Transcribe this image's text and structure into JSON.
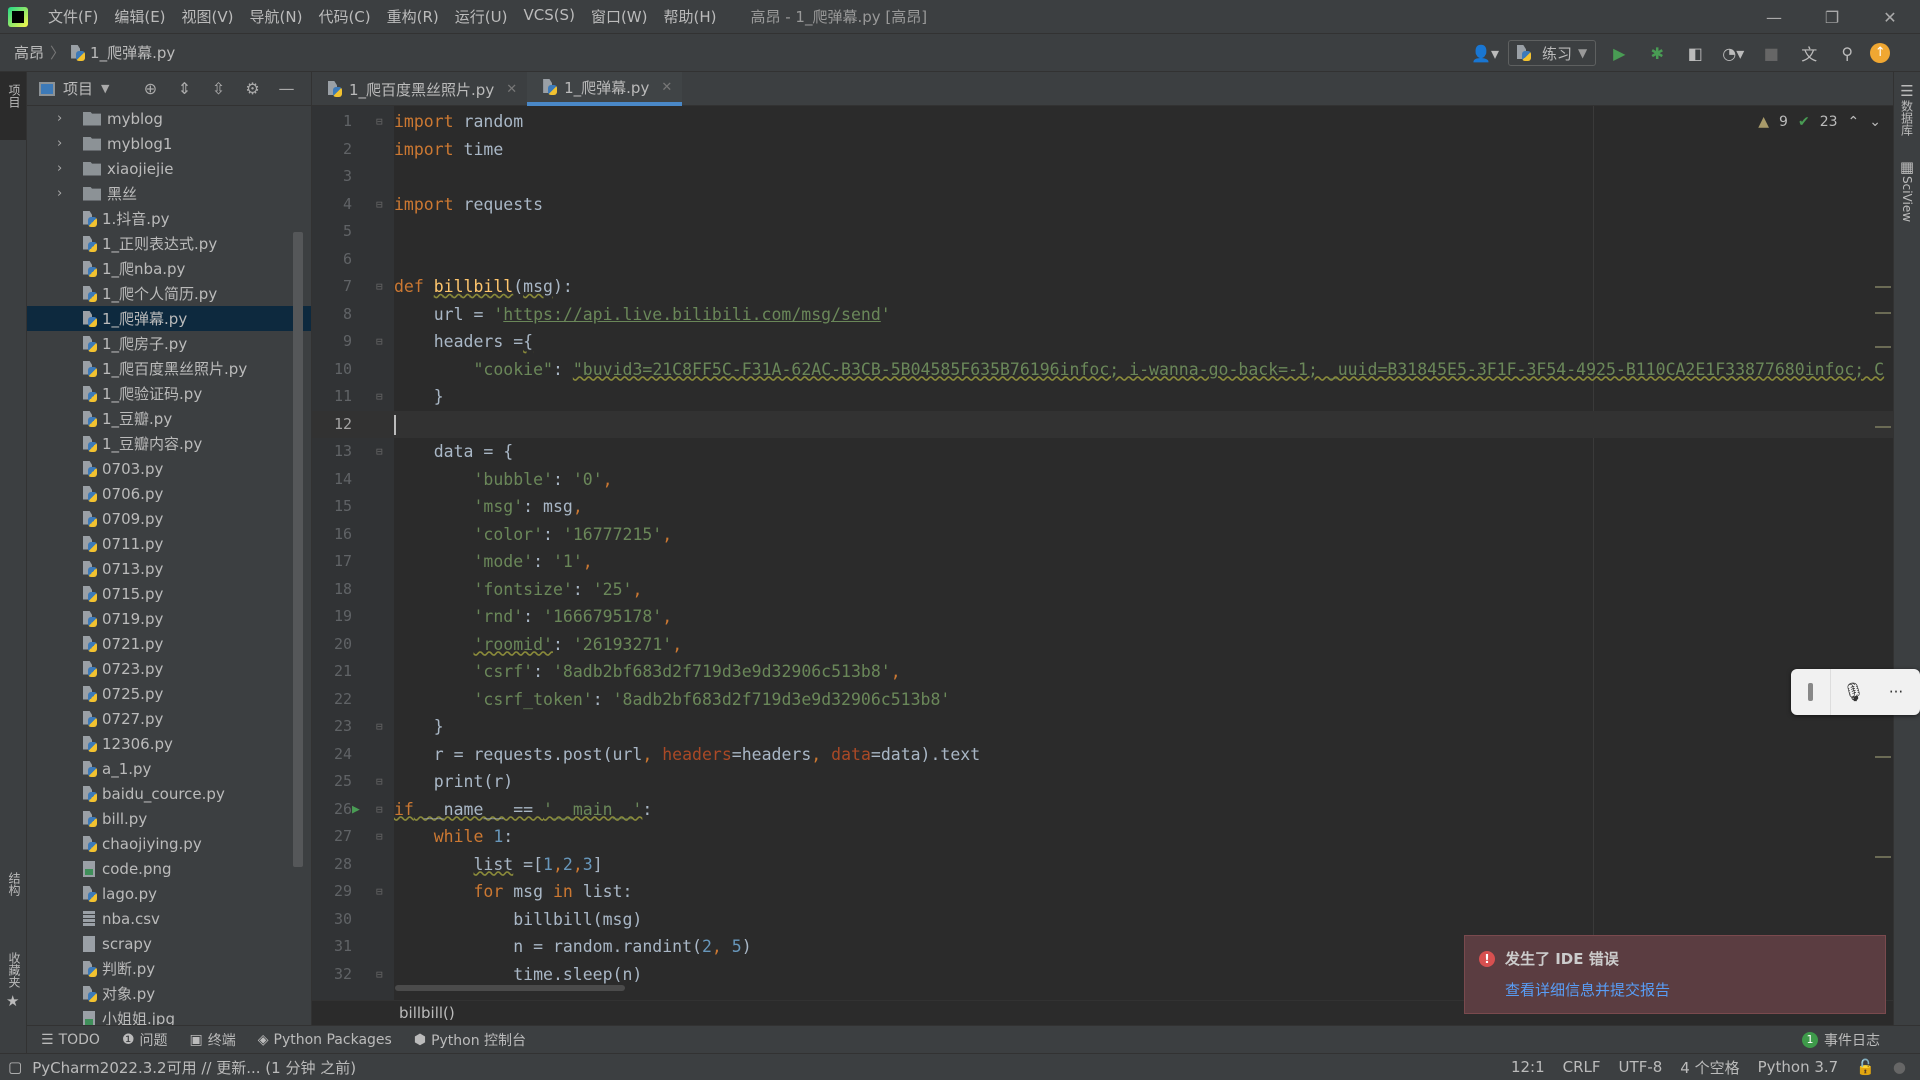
{
  "menu": [
    "文件(F)",
    "编辑(E)",
    "视图(V)",
    "导航(N)",
    "代码(C)",
    "重构(R)",
    "运行(U)",
    "VCS(S)",
    "窗口(W)",
    "帮助(H)"
  ],
  "window_title": "高昂 - 1_爬弹幕.py [高昂]",
  "breadcrumb": {
    "project": "高昂",
    "file": "1_爬弹幕.py"
  },
  "run_config": "练习",
  "left_strip": {
    "project": "项目",
    "structure": "结构",
    "favorites": "收藏夹"
  },
  "right_strip": {
    "database": "数据库",
    "sciview": "SciView"
  },
  "project_panel": {
    "title": "项目"
  },
  "tree": [
    {
      "type": "folder",
      "name": "myblog"
    },
    {
      "type": "folder",
      "name": "myblog1"
    },
    {
      "type": "folder",
      "name": "xiaojiejie"
    },
    {
      "type": "folder",
      "name": "黑丝"
    },
    {
      "type": "py",
      "name": "1.抖音.py"
    },
    {
      "type": "py",
      "name": "1_正则表达式.py"
    },
    {
      "type": "py",
      "name": "1_爬nba.py"
    },
    {
      "type": "py",
      "name": "1_爬个人简历.py"
    },
    {
      "type": "py",
      "name": "1_爬弹幕.py",
      "selected": true
    },
    {
      "type": "py",
      "name": "1_爬房子.py"
    },
    {
      "type": "py",
      "name": "1_爬百度黑丝照片.py"
    },
    {
      "type": "py",
      "name": "1_爬验证码.py"
    },
    {
      "type": "py",
      "name": "1_豆瓣.py"
    },
    {
      "type": "py",
      "name": "1_豆瓣内容.py"
    },
    {
      "type": "py",
      "name": "0703.py"
    },
    {
      "type": "py",
      "name": "0706.py"
    },
    {
      "type": "py",
      "name": "0709.py"
    },
    {
      "type": "py",
      "name": "0711.py"
    },
    {
      "type": "py",
      "name": "0713.py"
    },
    {
      "type": "py",
      "name": "0715.py"
    },
    {
      "type": "py",
      "name": "0719.py"
    },
    {
      "type": "py",
      "name": "0721.py"
    },
    {
      "type": "py",
      "name": "0723.py"
    },
    {
      "type": "py",
      "name": "0725.py"
    },
    {
      "type": "py",
      "name": "0727.py"
    },
    {
      "type": "py",
      "name": "12306.py"
    },
    {
      "type": "py",
      "name": "a_1.py"
    },
    {
      "type": "py",
      "name": "baidu_cource.py"
    },
    {
      "type": "py",
      "name": "bill.py"
    },
    {
      "type": "py",
      "name": "chaojiying.py"
    },
    {
      "type": "png",
      "name": "code.png"
    },
    {
      "type": "py",
      "name": "lago.py"
    },
    {
      "type": "csv",
      "name": "nba.csv"
    },
    {
      "type": "file",
      "name": "scrapy"
    },
    {
      "type": "py",
      "name": "判断.py"
    },
    {
      "type": "py",
      "name": "对象.py"
    },
    {
      "type": "png",
      "name": "小姐姐.jpg"
    }
  ],
  "tabs": [
    {
      "label": "1_爬百度黑丝照片.py",
      "active": false
    },
    {
      "label": "1_爬弹幕.py",
      "active": true
    }
  ],
  "inspections": {
    "warnings": "9",
    "weak_warnings": "23"
  },
  "current_line": 12,
  "code": [
    [
      [
        "import",
        "kw"
      ],
      [
        " random",
        ""
      ]
    ],
    [
      [
        "import",
        "kw"
      ],
      [
        " time",
        ""
      ]
    ],
    [],
    [
      [
        "import",
        "kw"
      ],
      [
        " requests",
        ""
      ]
    ],
    [],
    [],
    [
      [
        "def",
        "kw"
      ],
      [
        " ",
        ""
      ],
      [
        "billbill",
        "fn wavy"
      ],
      [
        "(",
        ""
      ],
      [
        "msg",
        "wavy"
      ],
      [
        "):",
        ""
      ]
    ],
    [
      [
        "    url = ",
        ""
      ],
      [
        "'",
        "str"
      ],
      [
        "https://api.live.bilibili.com/msg/send",
        "url"
      ],
      [
        "'",
        "str"
      ]
    ],
    [
      [
        "    headers =",
        ""
      ],
      [
        "{",
        "wavy"
      ]
    ],
    [
      [
        "        ",
        ""
      ],
      [
        "\"cookie\"",
        "str"
      ],
      [
        ": ",
        ""
      ],
      [
        "\"buvid3=21C8FF5C-F31A-62AC-B3CB-5B04585F635B76196infoc; i-wanna-go-back=-1; _uuid=B31845E5-3F1F-3F54-4925-B110CA2E1F33877680infoc; C",
        "str wavy"
      ]
    ],
    [
      [
        "    }",
        ""
      ]
    ],
    [],
    [
      [
        "    data = {",
        ""
      ]
    ],
    [
      [
        "        ",
        ""
      ],
      [
        "'bubble'",
        "str"
      ],
      [
        ": ",
        ""
      ],
      [
        "'0'",
        "str"
      ],
      [
        ",",
        "kw"
      ]
    ],
    [
      [
        "        ",
        ""
      ],
      [
        "'msg'",
        "str"
      ],
      [
        ": msg",
        ""
      ],
      [
        ",",
        "kw"
      ]
    ],
    [
      [
        "        ",
        ""
      ],
      [
        "'color'",
        "str"
      ],
      [
        ": ",
        ""
      ],
      [
        "'16777215'",
        "str"
      ],
      [
        ",",
        "kw"
      ]
    ],
    [
      [
        "        ",
        ""
      ],
      [
        "'mode'",
        "str"
      ],
      [
        ": ",
        ""
      ],
      [
        "'1'",
        "str"
      ],
      [
        ",",
        "kw"
      ]
    ],
    [
      [
        "        ",
        ""
      ],
      [
        "'fontsize'",
        "str"
      ],
      [
        ": ",
        ""
      ],
      [
        "'25'",
        "str"
      ],
      [
        ",",
        "kw"
      ]
    ],
    [
      [
        "        ",
        ""
      ],
      [
        "'rnd'",
        "str"
      ],
      [
        ": ",
        ""
      ],
      [
        "'1666795178'",
        "str"
      ],
      [
        ",",
        "kw"
      ]
    ],
    [
      [
        "        ",
        ""
      ],
      [
        "'roomid'",
        "str wavy"
      ],
      [
        ": ",
        ""
      ],
      [
        "'26193271'",
        "str"
      ],
      [
        ",",
        "kw"
      ]
    ],
    [
      [
        "        ",
        ""
      ],
      [
        "'csrf'",
        "str"
      ],
      [
        ": ",
        ""
      ],
      [
        "'8adb2bf683d2f719d3e9d32906c513b8'",
        "str"
      ],
      [
        ",",
        "kw"
      ]
    ],
    [
      [
        "        ",
        ""
      ],
      [
        "'csrf_token'",
        "str"
      ],
      [
        ": ",
        ""
      ],
      [
        "'8adb2bf683d2f719d3e9d32906c513b8'",
        "str"
      ]
    ],
    [
      [
        "    }",
        ""
      ]
    ],
    [
      [
        "    r = requests.post(url",
        ""
      ],
      [
        ", ",
        "kw"
      ],
      [
        "headers",
        "kwarg"
      ],
      [
        "=headers",
        ""
      ],
      [
        ", ",
        "kw"
      ],
      [
        "data",
        "kwarg"
      ],
      [
        "=data).text",
        ""
      ]
    ],
    [
      [
        "    print(r)",
        ""
      ]
    ],
    [
      [
        "if",
        "kw wavy"
      ],
      [
        " __name__ == ",
        "wavy"
      ],
      [
        "'__main__'",
        "str wavy"
      ],
      [
        ":",
        ""
      ]
    ],
    [
      [
        "    ",
        ""
      ],
      [
        "while",
        "kw"
      ],
      [
        " ",
        ""
      ],
      [
        "1",
        "num"
      ],
      [
        ":",
        ""
      ]
    ],
    [
      [
        "        ",
        ""
      ],
      [
        "list",
        "wavy"
      ],
      [
        " =[",
        ""
      ],
      [
        "1",
        "num"
      ],
      [
        ",",
        "kw"
      ],
      [
        "2",
        "num"
      ],
      [
        ",",
        "kw"
      ],
      [
        "3",
        "num"
      ],
      [
        "]",
        ""
      ]
    ],
    [
      [
        "        ",
        ""
      ],
      [
        "for",
        "kw"
      ],
      [
        " msg ",
        ""
      ],
      [
        "in",
        "kw"
      ],
      [
        " list:",
        ""
      ]
    ],
    [
      [
        "            billbill(msg)",
        ""
      ]
    ],
    [
      [
        "            n = random.randint(",
        ""
      ],
      [
        "2",
        "num"
      ],
      [
        ", ",
        "kw"
      ],
      [
        "5",
        "num"
      ],
      [
        ")",
        ""
      ]
    ],
    [
      [
        "            time.sleep(n)",
        ""
      ]
    ]
  ],
  "fold_lines": [
    1,
    4,
    7,
    9,
    11,
    13,
    23,
    25,
    26,
    27,
    29,
    32
  ],
  "run_lines": [
    26
  ],
  "editor_breadcrumb": "billbill()",
  "bottom_tools": [
    {
      "icon": "list-icon",
      "label": "TODO"
    },
    {
      "icon": "problems-icon",
      "label": "问题"
    },
    {
      "icon": "terminal-icon",
      "label": "终端"
    },
    {
      "icon": "packages-icon",
      "label": "Python Packages"
    },
    {
      "icon": "python-icon",
      "label": "Python 控制台"
    }
  ],
  "event_log": {
    "count": "1",
    "label": "事件日志"
  },
  "status": {
    "message": "PyCharm2022.3.2可用 // 更新... (1 分钟 之前)",
    "position": "12:1",
    "line_sep": "CRLF",
    "encoding": "UTF-8",
    "indent": "4 个空格",
    "interpreter": "Python 3.7"
  },
  "notification": {
    "title": "发生了 IDE 错误",
    "link": "查看详细信息并提交报告"
  },
  "colors": {
    "accent": "#4a88c7",
    "error_bg": "#5b3d41",
    "run_green": "#499c54"
  }
}
